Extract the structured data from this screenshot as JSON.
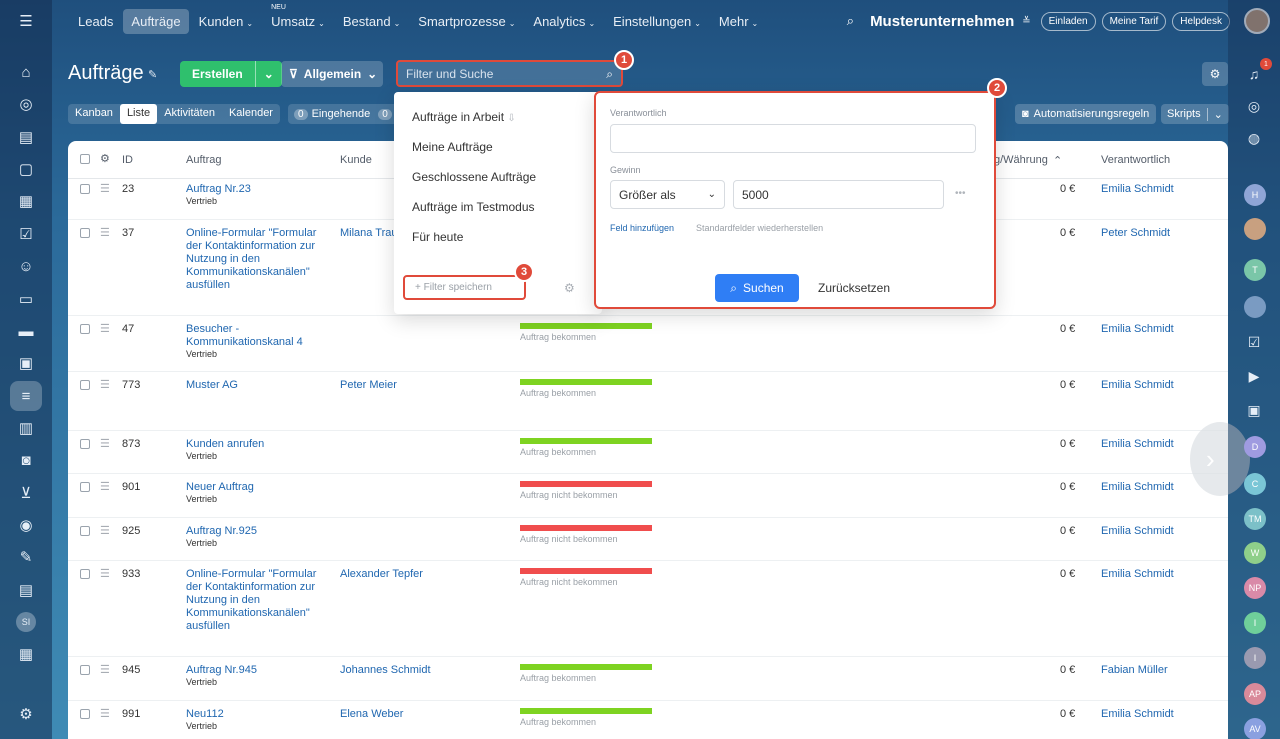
{
  "nav": {
    "items": [
      {
        "label": "Leads"
      },
      {
        "label": "Aufträge",
        "active": true
      },
      {
        "label": "Kunden",
        "chevron": "⌄"
      },
      {
        "label": "Umsatz",
        "chevron": "⌄",
        "badge": "NEU"
      },
      {
        "label": "Bestand",
        "chevron": "⌄"
      },
      {
        "label": "Smartprozesse",
        "chevron": "⌄"
      },
      {
        "label": "Analytics",
        "chevron": "⌄"
      },
      {
        "label": "Einstellungen",
        "chevron": "⌄"
      },
      {
        "label": "Mehr",
        "chevron": "⌄"
      }
    ],
    "company": "Musterunternehmen",
    "invite": "Einladen",
    "tariff": "Meine Tarif",
    "helpdesk": "Helpdesk"
  },
  "page": {
    "title": "Aufträge",
    "create_label": "Erstellen",
    "general_label": "Allgemein",
    "search_placeholder": "Filter und Suche"
  },
  "views": [
    "Kanban",
    "Liste",
    "Aktivitäten",
    "Kalender"
  ],
  "counter": {
    "count": "0",
    "label": "Eingehende",
    "count2": "0"
  },
  "toolbar": {
    "automation": "Automatisierungsregeln",
    "scripts": "Skripts"
  },
  "table": {
    "headers": {
      "id": "ID",
      "deal": "Auftrag",
      "client": "Kunde",
      "sum": "g/Währung",
      "responsible": "Verantwortlich"
    },
    "rows": [
      {
        "id": "23",
        "title": "Auftrag Nr.23",
        "sub": "Vertrieb",
        "client": "",
        "stage": "",
        "sum": "0 €",
        "resp": "Emilia Schmidt"
      },
      {
        "id": "37",
        "title": "Online-Formular \"Formular der Kontaktinformation zur Nutzung in den Kommunikationskanälen\" ausfüllen",
        "sub": "",
        "client": "Milana Trau",
        "stage": "",
        "sum": "0 €",
        "resp": "Peter Schmidt"
      },
      {
        "id": "47",
        "title": "Besucher - Kommunikationskanal 4",
        "sub": "Vertrieb",
        "client": "",
        "stage": "Auftrag bekommen",
        "sum": "0 €",
        "resp": "Emilia Schmidt"
      },
      {
        "id": "773",
        "title": "Muster AG",
        "sub": "",
        "client": "Peter Meier",
        "stage": "Auftrag bekommen",
        "sum": "0 €",
        "resp": "Emilia Schmidt"
      },
      {
        "id": "873",
        "title": "Kunden anrufen",
        "sub": "Vertrieb",
        "client": "",
        "stage": "Auftrag bekommen",
        "sum": "0 €",
        "resp": "Emilia Schmidt"
      },
      {
        "id": "901",
        "title": "Neuer Auftrag",
        "sub": "Vertrieb",
        "client": "",
        "stage": "Auftrag nicht bekommen",
        "sum": "0 €",
        "resp": "Emilia Schmidt"
      },
      {
        "id": "925",
        "title": "Auftrag Nr.925",
        "sub": "Vertrieb",
        "client": "",
        "stage": "Auftrag nicht bekommen",
        "sum": "0 €",
        "resp": "Emilia Schmidt"
      },
      {
        "id": "933",
        "title": "Online-Formular \"Formular der Kontaktinformation zur Nutzung in den Kommunikationskanälen\" ausfüllen",
        "sub": "",
        "client": "Alexander Tepfer",
        "stage": "Auftrag nicht bekommen",
        "sum": "0 €",
        "resp": "Emilia Schmidt"
      },
      {
        "id": "945",
        "title": "Auftrag Nr.945",
        "sub": "Vertrieb",
        "client": "Johannes Schmidt",
        "stage": "Auftrag bekommen",
        "sum": "0 €",
        "resp": "Fabian Müller"
      },
      {
        "id": "991",
        "title": "Neu112",
        "sub": "Vertrieb",
        "client": "Elena Weber",
        "stage": "Auftrag bekommen",
        "sum": "0 €",
        "resp": "Emilia Schmidt"
      }
    ]
  },
  "presets": {
    "items": [
      "Aufträge in Arbeit",
      "Meine Aufträge",
      "Geschlossene Aufträge",
      "Aufträge im Testmodus",
      "Für heute"
    ],
    "save_label": "+ Filter speichern"
  },
  "filter": {
    "responsible_label": "Verantwortlich",
    "responsible_value": "",
    "profit_label": "Gewinn",
    "operator": "Größer als",
    "value": "5000",
    "add_field": "Feld hinzufügen",
    "restore": "Standardfelder wiederherstellen",
    "search_btn": "Suchen",
    "reset_btn": "Zurücksetzen"
  },
  "markers": [
    "1",
    "2",
    "3"
  ],
  "colors": {
    "success": "#7ed321",
    "fail": "#f04d4d",
    "link": "#2067b0",
    "create": "#2fc06d",
    "highlight": "#e04a3a"
  },
  "rightbar": {
    "notification_count": "1",
    "avatars": [
      "H",
      "T",
      "D",
      "C",
      "TM",
      "W",
      "NP",
      "I",
      "I",
      "AP",
      "AV"
    ]
  },
  "leftbar": {
    "user_initials": "SI"
  }
}
